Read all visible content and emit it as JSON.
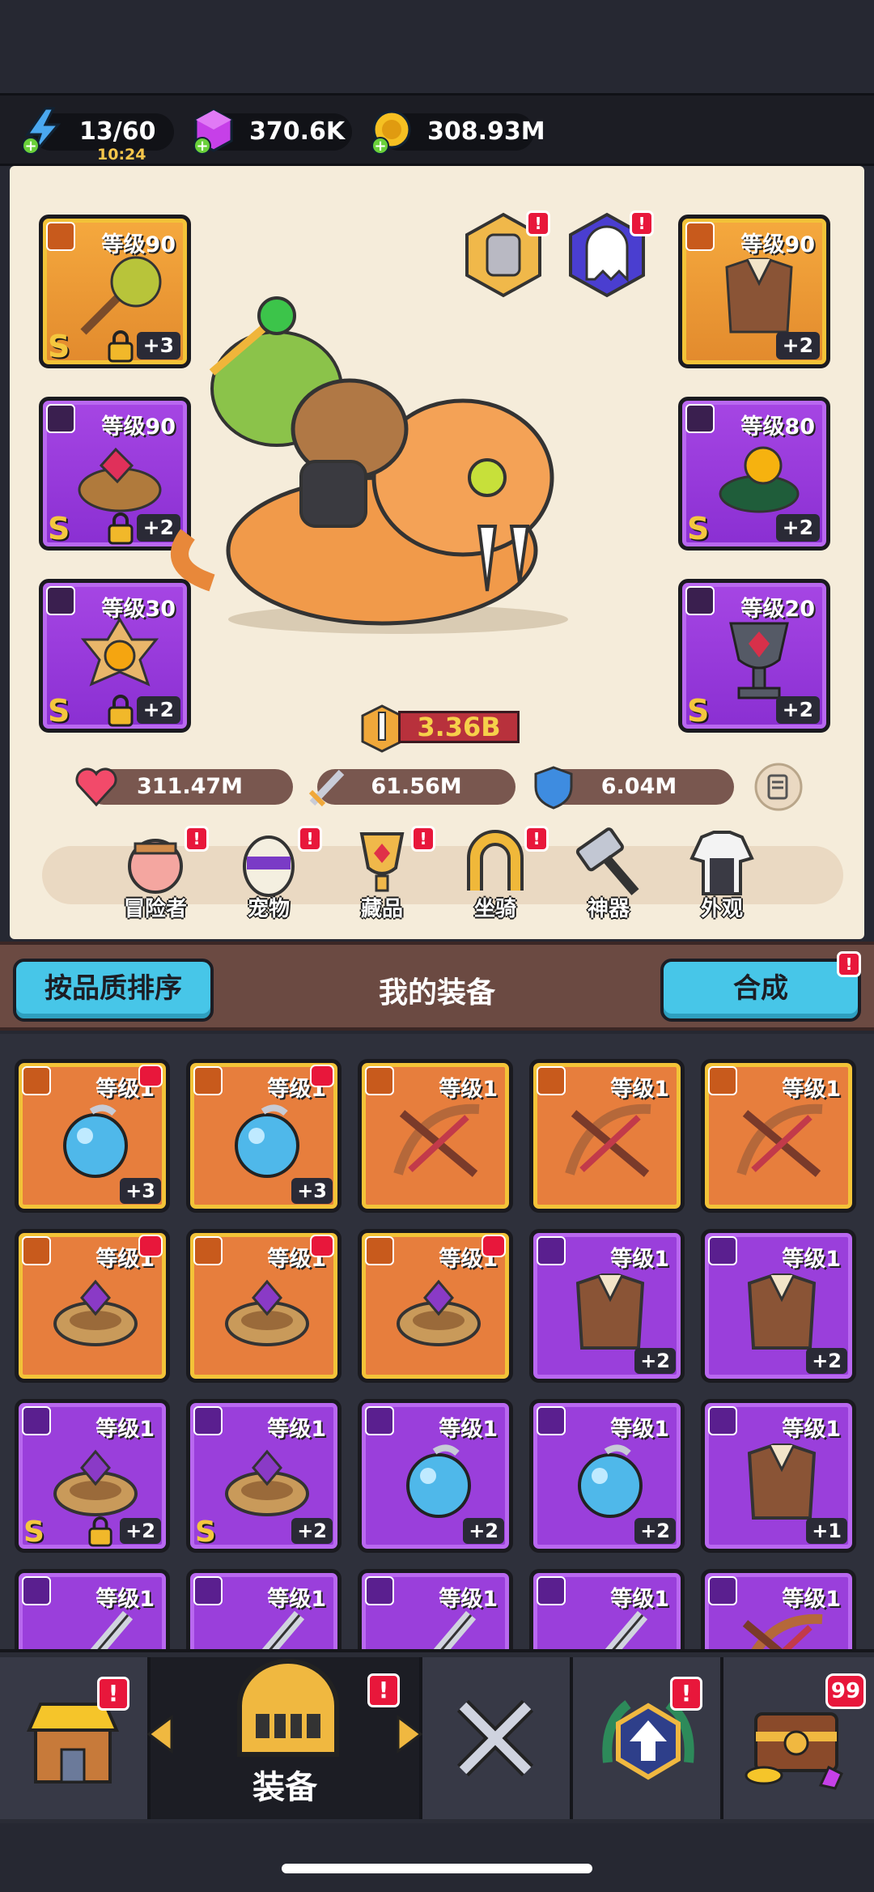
{
  "resources": {
    "energy": "13/60",
    "energy_timer": "10:24",
    "gems": "370.6K",
    "gold": "308.93M"
  },
  "equipped": {
    "left": [
      {
        "level": "等级90",
        "plus": "+3",
        "grade": "S",
        "rarity": "gold",
        "item": "mace",
        "locked": true
      },
      {
        "level": "等级90",
        "plus": "+2",
        "grade": "S",
        "rarity": "purple",
        "item": "ring",
        "locked": true
      },
      {
        "level": "等级30",
        "plus": "+2",
        "grade": "S",
        "rarity": "purple",
        "item": "amulet",
        "locked": true
      }
    ],
    "right": [
      {
        "level": "等级90",
        "plus": "+2",
        "grade": "",
        "rarity": "gold",
        "item": "armor",
        "locked": false
      },
      {
        "level": "等级80",
        "plus": "+2",
        "grade": "S",
        "rarity": "purple",
        "item": "ring",
        "locked": false
      },
      {
        "level": "等级20",
        "plus": "+2",
        "grade": "S",
        "rarity": "purple",
        "item": "goblet",
        "locked": false
      }
    ]
  },
  "power": "3.36B",
  "stats": {
    "hp": "311.47M",
    "attack": "61.56M",
    "defense": "6.04M"
  },
  "nav": {
    "adventurer": "冒险者",
    "pet": "宠物",
    "collection": "藏品",
    "mount": "坐骑",
    "artifact": "神器",
    "appearance": "外观"
  },
  "equipment": {
    "sort_label": "按品质排序",
    "title": "我的装备",
    "merge_label": "合成"
  },
  "items": [
    {
      "level": "等级1",
      "plus": "+3",
      "rarity": "orange",
      "item": "orb",
      "up": true,
      "grade": "",
      "locked": false
    },
    {
      "level": "等级1",
      "plus": "+3",
      "rarity": "orange",
      "item": "orb",
      "up": true,
      "grade": "",
      "locked": false
    },
    {
      "level": "等级1",
      "plus": "",
      "rarity": "orange",
      "item": "bow",
      "up": false,
      "grade": "",
      "locked": false
    },
    {
      "level": "等级1",
      "plus": "",
      "rarity": "orange",
      "item": "bow",
      "up": false,
      "grade": "",
      "locked": false
    },
    {
      "level": "等级1",
      "plus": "",
      "rarity": "orange",
      "item": "bow",
      "up": false,
      "grade": "",
      "locked": false
    },
    {
      "level": "等级1",
      "plus": "",
      "rarity": "orange",
      "item": "ring",
      "up": true,
      "grade": "",
      "locked": false
    },
    {
      "level": "等级1",
      "plus": "",
      "rarity": "orange",
      "item": "ring",
      "up": true,
      "grade": "",
      "locked": false
    },
    {
      "level": "等级1",
      "plus": "",
      "rarity": "orange",
      "item": "ring",
      "up": true,
      "grade": "",
      "locked": false
    },
    {
      "level": "等级1",
      "plus": "+2",
      "rarity": "purple",
      "item": "armor",
      "up": false,
      "grade": "",
      "locked": false
    },
    {
      "level": "等级1",
      "plus": "+2",
      "rarity": "purple",
      "item": "armor",
      "up": false,
      "grade": "",
      "locked": false
    },
    {
      "level": "等级1",
      "plus": "+2",
      "rarity": "purple",
      "item": "ring",
      "up": false,
      "grade": "S",
      "locked": true
    },
    {
      "level": "等级1",
      "plus": "+2",
      "rarity": "purple",
      "item": "ring",
      "up": false,
      "grade": "S",
      "locked": false
    },
    {
      "level": "等级1",
      "plus": "+2",
      "rarity": "purple",
      "item": "orb",
      "up": false,
      "grade": "",
      "locked": false
    },
    {
      "level": "等级1",
      "plus": "+2",
      "rarity": "purple",
      "item": "orb",
      "up": false,
      "grade": "",
      "locked": false
    },
    {
      "level": "等级1",
      "plus": "+1",
      "rarity": "purple",
      "item": "armor",
      "up": false,
      "grade": "",
      "locked": false
    },
    {
      "level": "等级1",
      "plus": "",
      "rarity": "purple",
      "item": "sword",
      "up": false,
      "grade": "",
      "locked": false
    },
    {
      "level": "等级1",
      "plus": "",
      "rarity": "purple",
      "item": "sword",
      "up": false,
      "grade": "",
      "locked": false
    },
    {
      "level": "等级1",
      "plus": "",
      "rarity": "purple",
      "item": "sword",
      "up": false,
      "grade": "",
      "locked": false
    },
    {
      "level": "等级1",
      "plus": "",
      "rarity": "purple",
      "item": "sword",
      "up": false,
      "grade": "",
      "locked": false
    },
    {
      "level": "等级1",
      "plus": "",
      "rarity": "purple",
      "item": "bow",
      "up": false,
      "grade": "",
      "locked": false
    }
  ],
  "tabs": {
    "equipment_label": "装备",
    "chest_count": "99"
  },
  "alert_mark": "!"
}
